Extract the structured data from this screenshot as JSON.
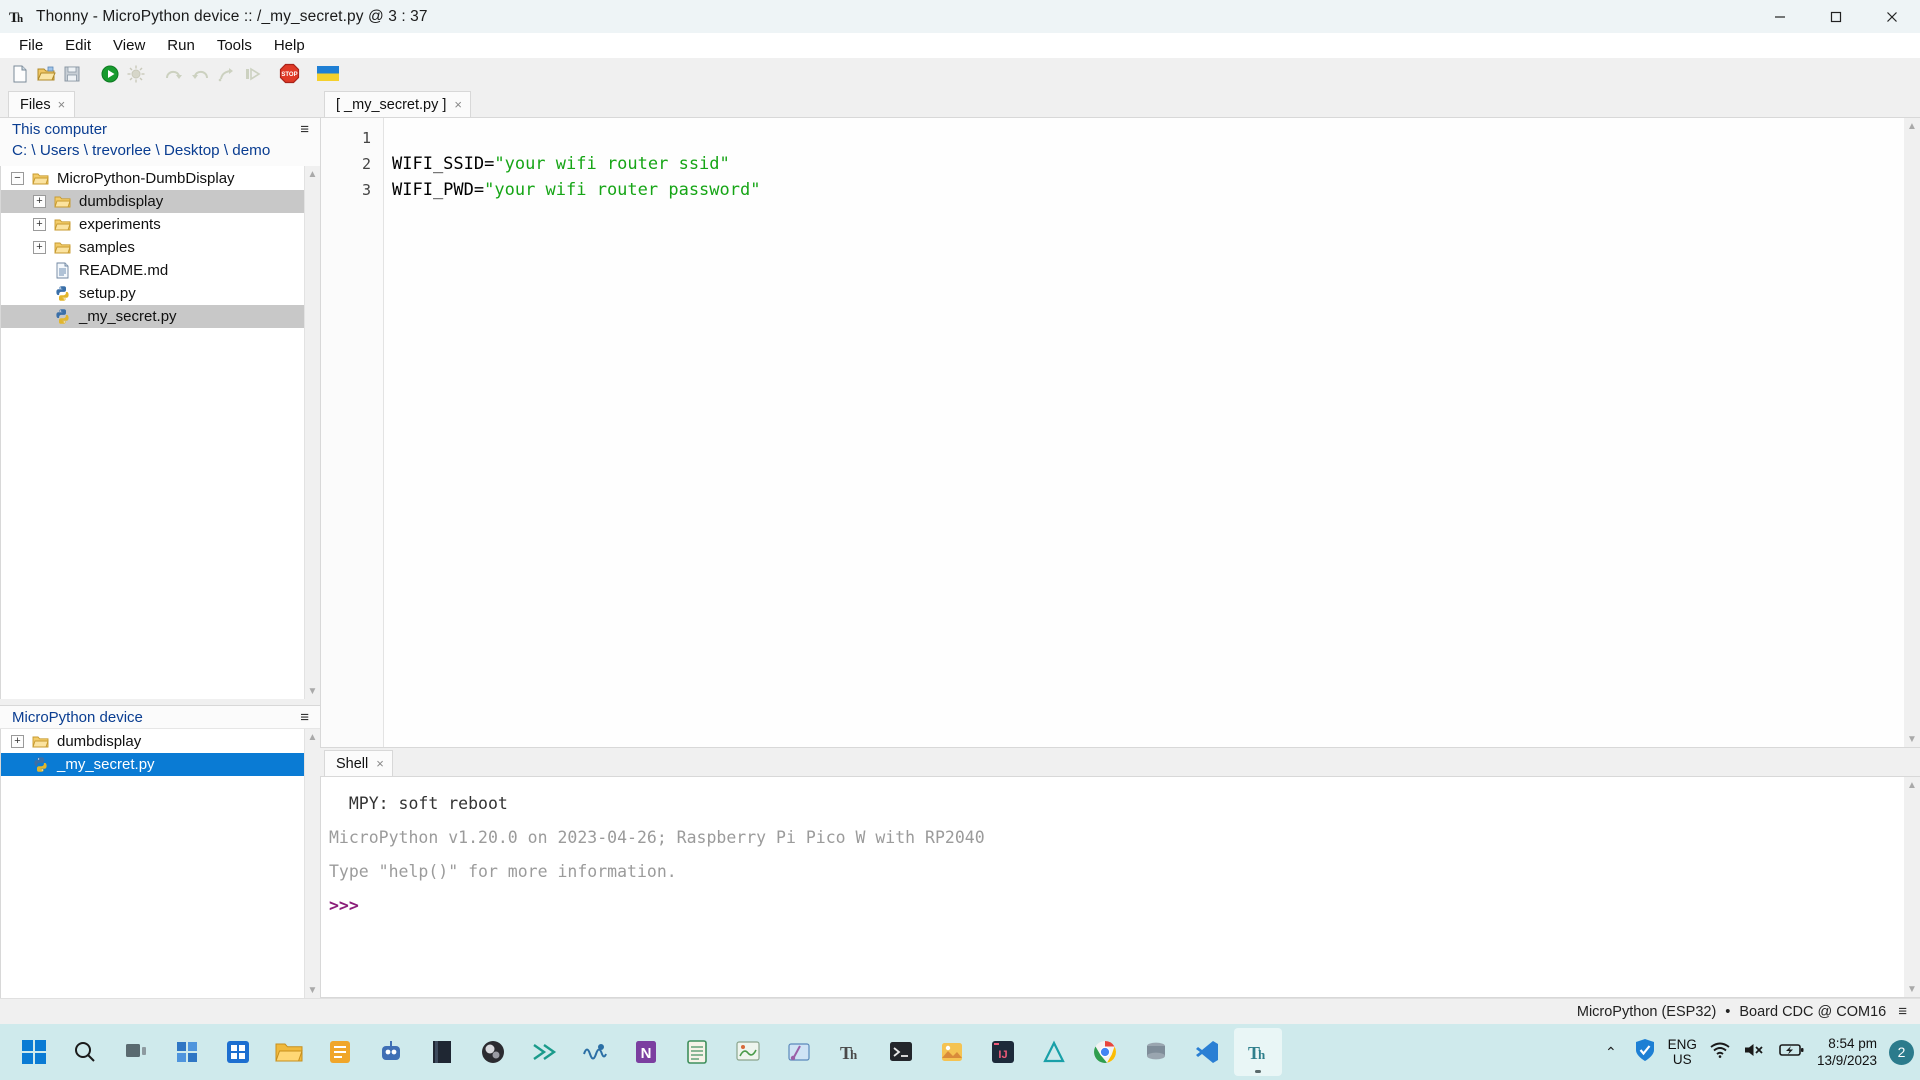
{
  "window": {
    "title": "Thonny  -  MicroPython device :: /_my_secret.py  @  3 : 37",
    "app_icon": "thonny-icon",
    "minimize": "minimize-button",
    "maximize": "maximize-button",
    "close": "close-button"
  },
  "menu": {
    "items": [
      {
        "label": "File"
      },
      {
        "label": "Edit"
      },
      {
        "label": "View"
      },
      {
        "label": "Run"
      },
      {
        "label": "Tools"
      },
      {
        "label": "Help"
      }
    ]
  },
  "toolbar": {
    "buttons": [
      {
        "name": "new-file-icon",
        "title": "New"
      },
      {
        "name": "open-file-icon",
        "title": "Load"
      },
      {
        "name": "save-file-icon",
        "title": "Save"
      },
      {
        "name": "run-icon",
        "title": "Run current script"
      },
      {
        "name": "debug-icon",
        "title": "Debug current script"
      },
      {
        "name": "step-over-icon",
        "title": "Step over"
      },
      {
        "name": "step-into-icon",
        "title": "Step into"
      },
      {
        "name": "step-out-icon",
        "title": "Step out"
      },
      {
        "name": "resume-icon",
        "title": "Resume"
      },
      {
        "name": "stop-icon",
        "title": "Stop / Restart backend"
      },
      {
        "name": "ukraine-flag-icon",
        "title": "Support Ukraine"
      }
    ]
  },
  "files_panel": {
    "tab_label": "Files",
    "tab_close": "×",
    "menu_icon": "hamburger-icon",
    "this_computer": "This computer",
    "path": "C: \\ Users \\ trevorlee \\ Desktop \\ demo",
    "tree": [
      {
        "label": "MicroPython-DumbDisplay",
        "icon": "folder-icon",
        "expander": "−",
        "indent": 0,
        "state": "none"
      },
      {
        "label": "dumbdisplay",
        "icon": "folder-icon",
        "expander": "+",
        "indent": 1,
        "state": "selected-grey"
      },
      {
        "label": "experiments",
        "icon": "folder-icon",
        "expander": "+",
        "indent": 1,
        "state": "none"
      },
      {
        "label": "samples",
        "icon": "folder-icon",
        "expander": "+",
        "indent": 1,
        "state": "none"
      },
      {
        "label": "README.md",
        "icon": "markdown-file-icon",
        "expander": "",
        "indent": 1,
        "state": "none"
      },
      {
        "label": "setup.py",
        "icon": "python-file-icon",
        "expander": "",
        "indent": 1,
        "state": "none"
      },
      {
        "label": "_my_secret.py",
        "icon": "python-file-icon",
        "expander": "",
        "indent": 1,
        "state": "selected-grey"
      }
    ]
  },
  "device_panel": {
    "title": "MicroPython device",
    "menu_icon": "hamburger-icon",
    "tree": [
      {
        "label": "dumbdisplay",
        "icon": "folder-icon",
        "expander": "+",
        "indent": 0,
        "state": "none"
      },
      {
        "label": "_my_secret.py",
        "icon": "python-file-icon",
        "expander": "",
        "indent": 0,
        "state": "selected-blue"
      }
    ]
  },
  "editor": {
    "tab_label": "[ _my_secret.py ]",
    "tab_close": "×",
    "line_numbers": [
      "1",
      "2",
      "3"
    ],
    "lines": [
      {
        "pre": "",
        "str": "",
        "post": ""
      },
      {
        "pre": "WIFI_SSID=",
        "str": "\"your wifi router ssid\"",
        "post": ""
      },
      {
        "pre": "WIFI_PWD=",
        "str": "\"your wifi router password\"",
        "post": ""
      }
    ],
    "string_color": "#16a516"
  },
  "shell": {
    "tab_label": "Shell",
    "tab_close": "×",
    "lines": [
      {
        "text": "  MPY: soft reboot",
        "style": "dark"
      },
      {
        "text": "MicroPython v1.20.0 on 2023-04-26; Raspberry Pi Pico W with RP2040",
        "style": "grey"
      },
      {
        "text": "Type \"help()\" for more information.",
        "style": "grey"
      },
      {
        "text": ">>>",
        "style": "prompt"
      }
    ]
  },
  "statusbar": {
    "backend": "MicroPython (ESP32)",
    "separator": "•",
    "connection": "Board CDC @ COM16",
    "menu_icon": "hamburger-icon"
  },
  "taskbar": {
    "items": [
      {
        "name": "start-button",
        "label": "Start"
      },
      {
        "name": "search-icon",
        "label": "Search"
      },
      {
        "name": "task-view-icon",
        "label": "Task View"
      },
      {
        "name": "widgets-icon",
        "label": "Widgets"
      },
      {
        "name": "microsoft-store-icon",
        "label": "Microsoft Store"
      },
      {
        "name": "file-explorer-icon",
        "label": "File Explorer"
      },
      {
        "name": "notes-app-icon",
        "label": "Notes"
      },
      {
        "name": "robot-app-icon",
        "label": "Robot app"
      },
      {
        "name": "book-app-icon",
        "label": "Book app"
      },
      {
        "name": "obs-studio-icon",
        "label": "OBS Studio"
      },
      {
        "name": "sketch-app-icon",
        "label": "Sketch app"
      },
      {
        "name": "audacity-icon",
        "label": "Audacity"
      },
      {
        "name": "onenote-icon",
        "label": "OneNote"
      },
      {
        "name": "notepad-icon",
        "label": "Notepad"
      },
      {
        "name": "paint-icon",
        "label": "Paint"
      },
      {
        "name": "snipping-tool-icon",
        "label": "Snipping Tool"
      },
      {
        "name": "thonny-icon-1",
        "label": "Thonny"
      },
      {
        "name": "terminal-icon",
        "label": "Terminal"
      },
      {
        "name": "photos-icon",
        "label": "Photos"
      },
      {
        "name": "intellij-icon",
        "label": "IntelliJ IDEA"
      },
      {
        "name": "arduino-icon",
        "label": "Arduino"
      },
      {
        "name": "chrome-icon",
        "label": "Google Chrome"
      },
      {
        "name": "database-icon",
        "label": "Database tool"
      },
      {
        "name": "vscode-icon",
        "label": "Visual Studio Code"
      },
      {
        "name": "thonny-icon-2",
        "label": "Thonny"
      }
    ],
    "tray": {
      "chevron": "⌃",
      "security_icon": "windows-security-icon",
      "lang_line1": "ENG",
      "lang_line2": "US",
      "wifi_icon": "wifi-icon",
      "volume_icon": "volume-muted-icon",
      "battery_icon": "battery-charging-icon",
      "time": "8:54 pm",
      "date": "13/9/2023",
      "notification_count": "2"
    }
  }
}
